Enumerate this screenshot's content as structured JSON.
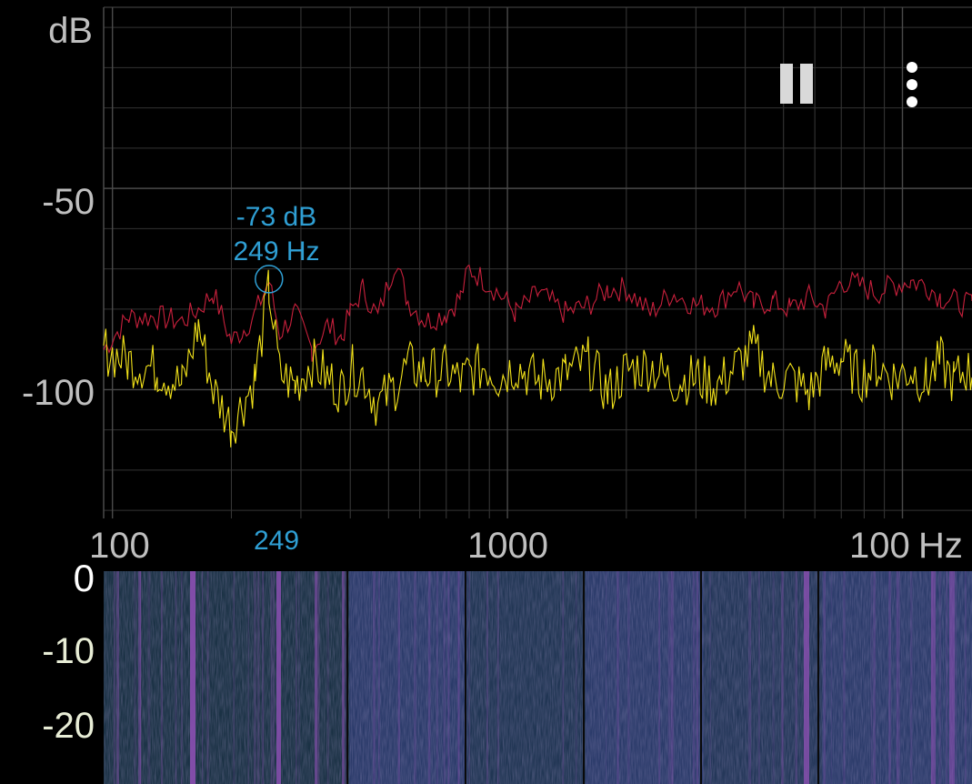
{
  "spectrum": {
    "y_unit": "dB",
    "x_unit": "Hz",
    "y_tick_labels": [
      "-50",
      "-100"
    ],
    "x_tick_labels": [
      "100",
      "1000",
      "100"
    ],
    "peak": {
      "db_label": "-73 dB",
      "hz_label": "249 Hz",
      "axis_label": "249",
      "freq_hz": 249,
      "db": -73
    },
    "colors": {
      "grid": "#4a4a4a",
      "grid_minor": "#2e2e2e",
      "peak_hold": "#c8203c",
      "live": "#f2e21a",
      "marker": "#2f9fd4"
    }
  },
  "controls": {
    "pause_icon": "pause-icon",
    "menu_icon": "more-vert-icon"
  },
  "waterfall": {
    "time_labels": [
      "0",
      "-10",
      "-20"
    ],
    "colors": {
      "base": "#2b3b6a",
      "dark": "#17303a",
      "band": "#8a4fb0"
    }
  },
  "chart_data": {
    "type": "line",
    "xlabel": "Hz",
    "ylabel": "dB",
    "x_scale": "log",
    "xlim": [
      95,
      15000
    ],
    "ylim": [
      -132,
      -5
    ],
    "x_ticks": [
      100,
      1000,
      10000
    ],
    "y_ticks": [
      -50,
      -100
    ],
    "grid": true,
    "series": [
      {
        "x": [
          95,
          110,
          130,
          150,
          165,
          180,
          200,
          215,
          230,
          249,
          265,
          290,
          320,
          350,
          380,
          400,
          430,
          470,
          520,
          560,
          620,
          700,
          760,
          800,
          880,
          950,
          1050,
          1200,
          1400,
          1600,
          1800,
          2000,
          2300,
          2600,
          3000,
          3400,
          3800,
          4200,
          4700,
          5200,
          5800,
          6400,
          7000,
          7800,
          8600,
          9500,
          10500,
          11500,
          12500,
          13500,
          14500,
          15000
        ],
        "y": [
          -90,
          -82,
          -82,
          -83,
          -80,
          -76,
          -88,
          -85,
          -81,
          -73,
          -86,
          -81,
          -90,
          -84,
          -87,
          -81,
          -75,
          -82,
          -68,
          -78,
          -83,
          -81,
          -77,
          -70,
          -73,
          -76,
          -81,
          -76,
          -81,
          -79,
          -75,
          -75,
          -81,
          -76,
          -79,
          -79,
          -74,
          -79,
          -78,
          -80,
          -77,
          -80,
          -73,
          -74,
          -76,
          -74,
          -73,
          -74,
          -77,
          -78,
          -79,
          -78
        ]
      },
      {
        "x": [
          95,
          110,
          130,
          150,
          165,
          180,
          200,
          215,
          230,
          249,
          265,
          290,
          320,
          350,
          380,
          400,
          430,
          470,
          520,
          560,
          620,
          700,
          760,
          800,
          880,
          950,
          1050,
          1200,
          1400,
          1600,
          1800,
          2000,
          2300,
          2600,
          3000,
          3400,
          3800,
          4200,
          4700,
          5200,
          5800,
          6400,
          7000,
          7800,
          8600,
          9500,
          10500,
          11500,
          12500,
          13500,
          14500,
          15000
        ],
        "y": [
          -90,
          -93,
          -95,
          -99,
          -84,
          -100,
          -109,
          -103,
          -97,
          -75,
          -96,
          -99,
          -93,
          -97,
          -100,
          -95,
          -96,
          -104,
          -99,
          -94,
          -96,
          -95,
          -98,
          -96,
          -94,
          -97,
          -94,
          -98,
          -96,
          -93,
          -101,
          -95,
          -94,
          -98,
          -97,
          -99,
          -94,
          -90,
          -98,
          -97,
          -101,
          -94,
          -92,
          -97,
          -94,
          -97,
          -95,
          -98,
          -93,
          -98,
          -95,
          -97
        ]
      }
    ]
  }
}
